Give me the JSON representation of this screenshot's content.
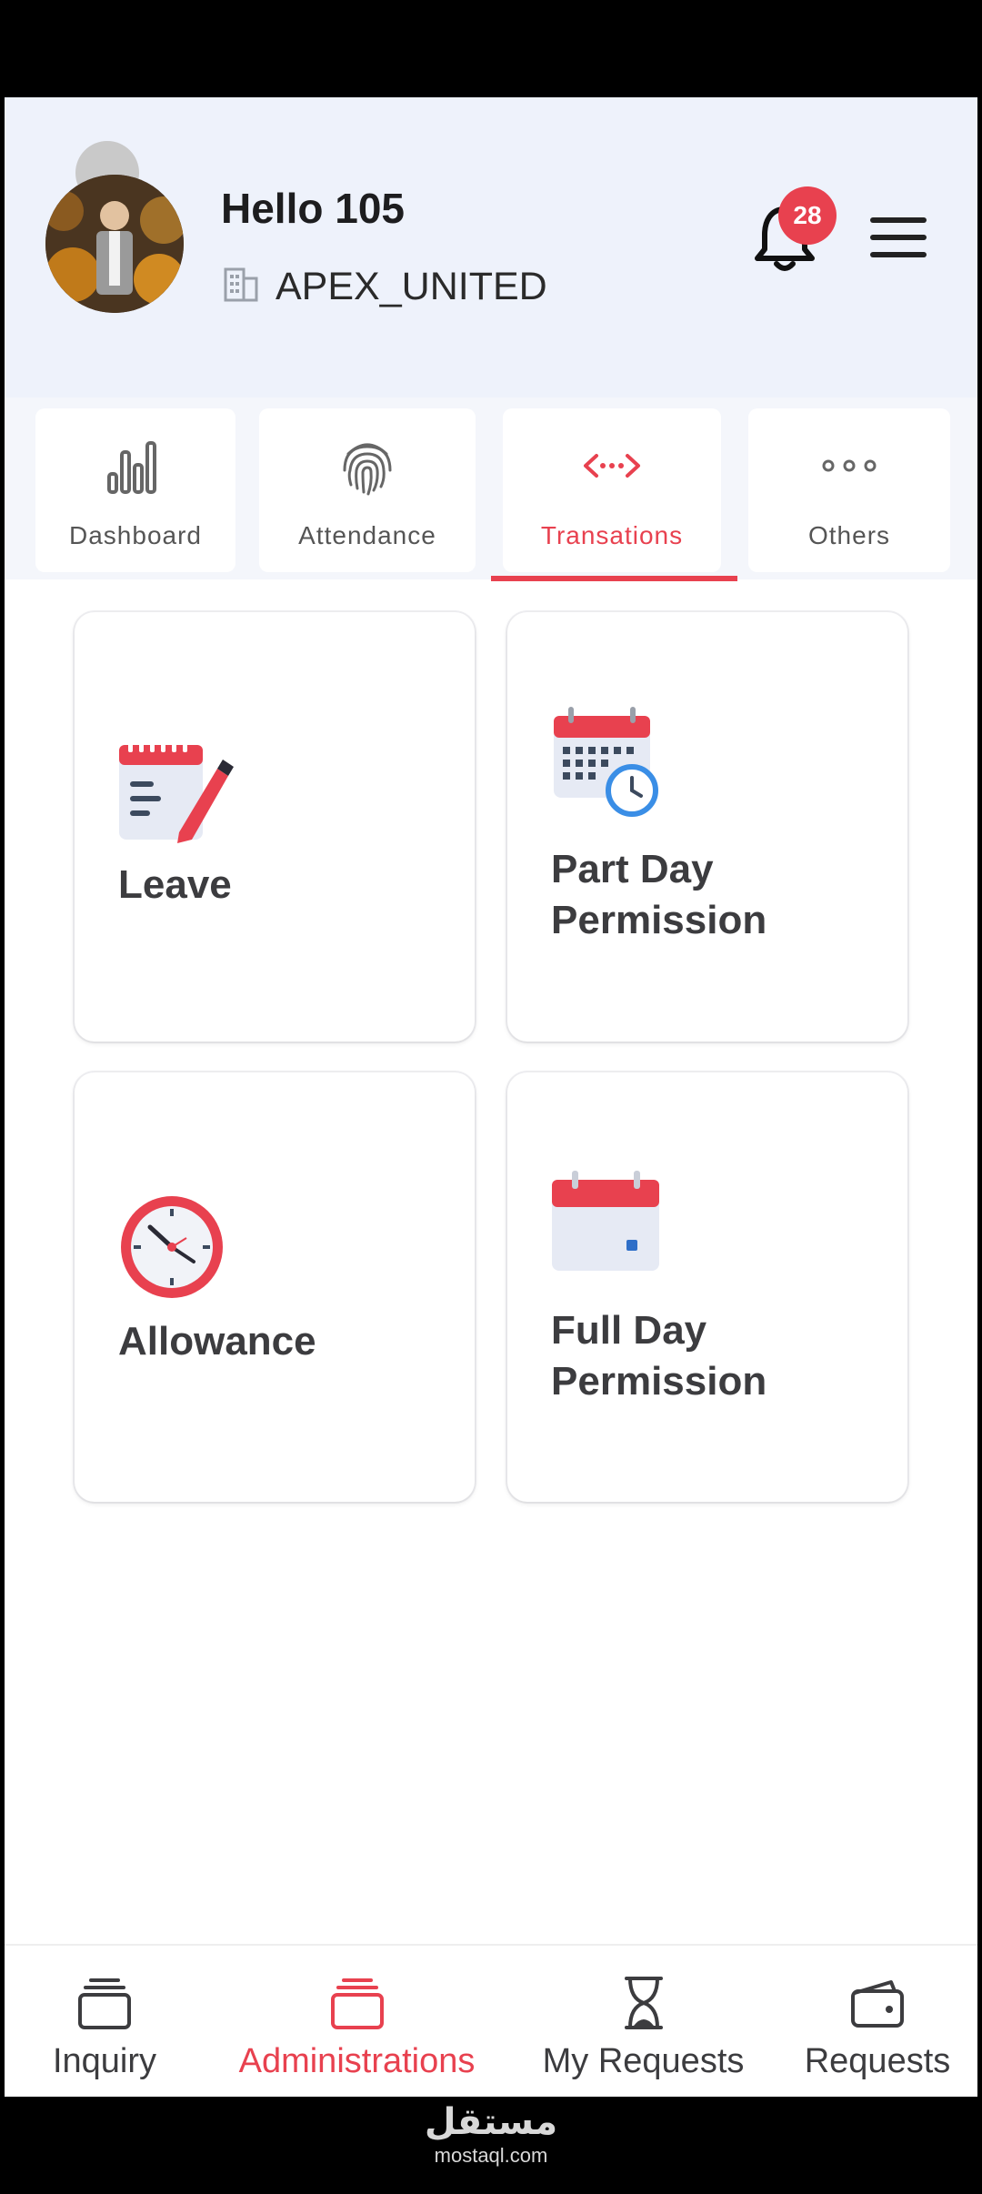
{
  "header": {
    "greeting": "Hello 105",
    "company": "APEX_UNITED",
    "notification_count": "28"
  },
  "tabs": [
    {
      "label": "Dashboard",
      "icon": "bar-chart-icon",
      "active": false
    },
    {
      "label": "Attendance",
      "icon": "fingerprint-icon",
      "active": false
    },
    {
      "label": "Transations",
      "icon": "code-arrows-icon",
      "active": true
    },
    {
      "label": "Others",
      "icon": "more-dots-icon",
      "active": false
    }
  ],
  "cards": [
    {
      "title": "Leave",
      "icon": "notepad-pen-icon"
    },
    {
      "title": "Part Day Permission",
      "icon": "calendar-clock-icon"
    },
    {
      "title": "Allowance",
      "icon": "clock-icon"
    },
    {
      "title": "Full Day Permission",
      "icon": "calendar-icon"
    }
  ],
  "bottom_nav": [
    {
      "label": "Inquiry",
      "icon": "stack-icon",
      "active": false
    },
    {
      "label": "Administrations",
      "icon": "stack-icon",
      "active": true
    },
    {
      "label": "My Requests",
      "icon": "hourglass-icon",
      "active": false
    },
    {
      "label": "Requests",
      "icon": "wallet-icon",
      "active": false
    }
  ],
  "watermark": {
    "arabic": "مستقل",
    "latin": "mostaql.com"
  },
  "colors": {
    "accent": "#e8414f",
    "header_bg": "#eef2fb",
    "text_dark": "#3c3c3f"
  }
}
